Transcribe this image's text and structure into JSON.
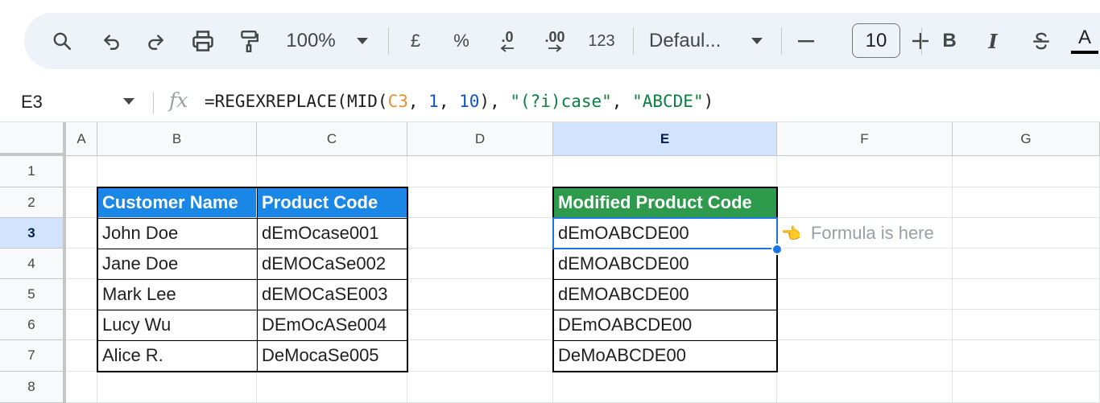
{
  "toolbar": {
    "zoom": "100%",
    "currency": "£",
    "percent": "%",
    "decrease_decimal": ".0",
    "increase_decimal": ".00",
    "number_format": "123",
    "font": "Defaul...",
    "font_size": "10",
    "bold": "B",
    "italic": "I",
    "text_color": "A"
  },
  "formula_bar": {
    "name_box": "E3",
    "fx": "fx",
    "parts": {
      "p1": "=REGEXREPLACE(MID(",
      "ref": "C3",
      "p2": ", ",
      "n1": "1",
      "p3": ", ",
      "n2": "10",
      "p4": "), ",
      "s1": "\"(?i)case\"",
      "p5": ", ",
      "s2": "\"ABCDE\"",
      "p6": ")"
    }
  },
  "columns": [
    "A",
    "B",
    "C",
    "D",
    "E",
    "F",
    "G"
  ],
  "rows": [
    "1",
    "2",
    "3",
    "4",
    "5",
    "6",
    "7",
    "8"
  ],
  "table1": {
    "headers": [
      "Customer Name",
      "Product Code"
    ],
    "rows": [
      [
        "John Doe",
        "dEmOcase001"
      ],
      [
        "Jane Doe",
        "dEMOCaSe002"
      ],
      [
        "Mark Lee",
        "dEMOCaSE003"
      ],
      [
        "Lucy Wu",
        "DEmOcASe004"
      ],
      [
        "Alice R.",
        "DeMocaSe005"
      ]
    ]
  },
  "table2": {
    "header": "Modified Product Code",
    "values": [
      "dEmOABCDE00",
      "dEMOABCDE00",
      "dEMOABCDE00",
      "DEmOABCDE00",
      "DeMoABCDE00"
    ]
  },
  "annotation": {
    "hand": "👈",
    "text": "Formula is here"
  },
  "colors": {
    "header_blue": "#1a86e6",
    "header_green": "#2e9a4c",
    "selection": "#1a73e8"
  }
}
